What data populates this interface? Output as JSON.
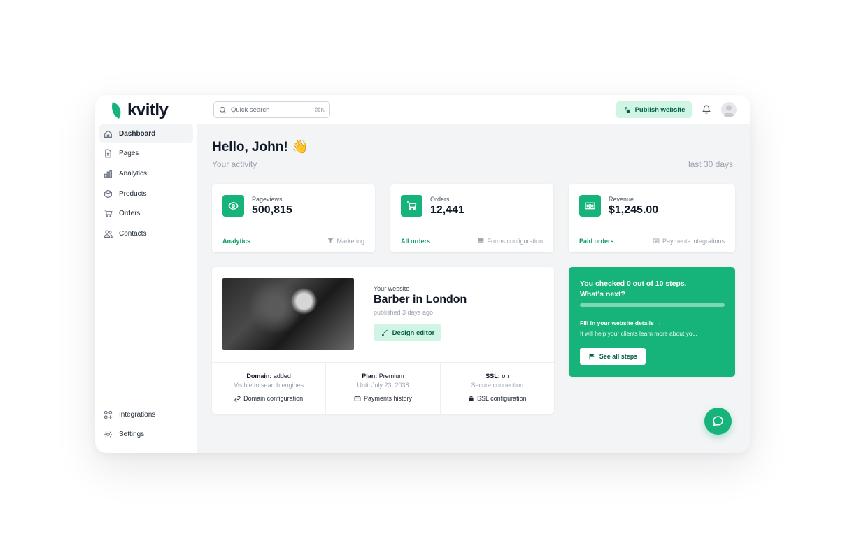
{
  "brand": {
    "name": "kvitly",
    "accent": "#16b37a",
    "accent_light": "#d1f5e4"
  },
  "sidebar": {
    "items": [
      {
        "label": "Dashboard",
        "icon": "home-icon",
        "active": true
      },
      {
        "label": "Pages",
        "icon": "page-icon"
      },
      {
        "label": "Analytics",
        "icon": "bar-chart-icon"
      },
      {
        "label": "Products",
        "icon": "box-icon"
      },
      {
        "label": "Orders",
        "icon": "cart-icon"
      },
      {
        "label": "Contacts",
        "icon": "users-icon"
      }
    ],
    "bottom_items": [
      {
        "label": "Integrations",
        "icon": "grid-plus-icon"
      },
      {
        "label": "Settings",
        "icon": "gear-icon"
      }
    ]
  },
  "topbar": {
    "search_placeholder": "Quick search",
    "search_shortcut": "⌘K",
    "publish_label": "Publish website"
  },
  "header": {
    "greeting": "Hello, John! 👋",
    "subtitle": "Your activity",
    "range": "last 30 days"
  },
  "stats": [
    {
      "label": "Pageviews",
      "value": "500,815",
      "icon": "eye-icon",
      "link": "Analytics",
      "secondary": "Marketing",
      "secondary_icon": "filter-icon"
    },
    {
      "label": "Orders",
      "value": "12,441",
      "icon": "cart-icon",
      "link": "All orders",
      "secondary": "Forms configuration",
      "secondary_icon": "stack-icon"
    },
    {
      "label": "Revenue",
      "value": "$1,245.00",
      "icon": "money-icon",
      "link": "Paid orders",
      "secondary": "Payments integrations",
      "secondary_icon": "money-icon"
    }
  ],
  "website": {
    "label": "Your website",
    "name": "Barber in London",
    "published": "published 3 days ago",
    "design_button": "Design editor",
    "details": [
      {
        "title_bold": "Domain:",
        "title_rest": " added",
        "sub": "Visible to search engines",
        "link": "Domain configuration",
        "icon": "link-icon"
      },
      {
        "title_bold": "Plan:",
        "title_rest": " Premium",
        "sub": "Until July 23, 2038",
        "link": "Payments history",
        "icon": "card-icon"
      },
      {
        "title_bold": "SSL:",
        "title_rest": " on",
        "sub": "Secure connection",
        "link": "SSL configuration",
        "icon": "lock-icon"
      }
    ]
  },
  "steps": {
    "title_line1": "You checked 0 out of 10 steps.",
    "title_line2": "What's next?",
    "progress": 0,
    "link": "Fill in your website details →",
    "description": "It will help your clients learn more about you.",
    "button": "See all steps"
  }
}
